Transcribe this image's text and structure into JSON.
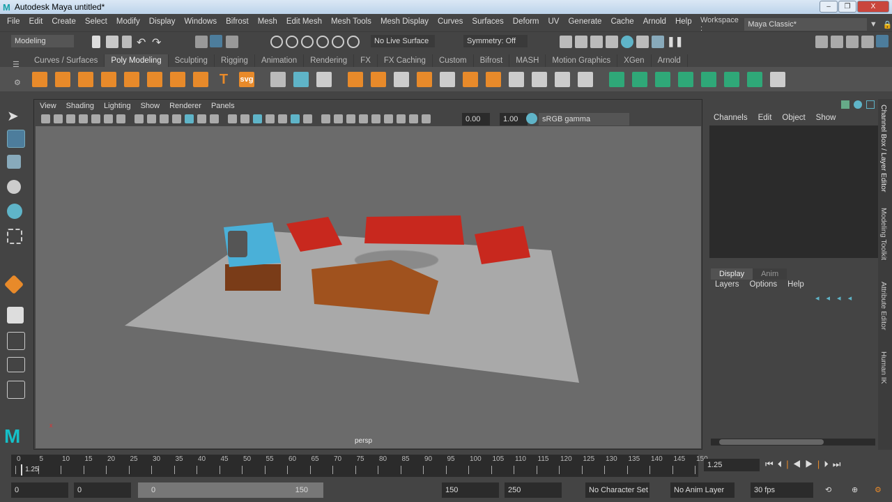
{
  "window": {
    "title": "Autodesk Maya  untitled*",
    "logo": "M",
    "min": "–",
    "max": "❐",
    "close": "X"
  },
  "menu": [
    "File",
    "Edit",
    "Create",
    "Select",
    "Modify",
    "Display",
    "Windows",
    "Bifrost",
    "Mesh",
    "Edit Mesh",
    "Mesh Tools",
    "Mesh Display",
    "Curves",
    "Surfaces",
    "Deform",
    "UV",
    "Generate",
    "Cache",
    "Arnold",
    "Help"
  ],
  "workspace": {
    "label": "Workspace :",
    "value": "Maya Classic*"
  },
  "status": {
    "menuset": "Modeling",
    "live_surface": "No Live Surface",
    "symmetry": "Symmetry: Off"
  },
  "shelf_tabs": [
    "Curves / Surfaces",
    "Poly Modeling",
    "Sculpting",
    "Rigging",
    "Animation",
    "Rendering",
    "FX",
    "FX Caching",
    "Custom",
    "Bifrost",
    "MASH",
    "Motion Graphics",
    "XGen",
    "Arnold"
  ],
  "shelf_active": "Poly Modeling",
  "shelf_icons": [
    "poly-sphere-icon",
    "poly-cube-icon",
    "poly-cylinder-icon",
    "poly-cone-icon",
    "poly-torus-icon",
    "poly-plane-icon",
    "poly-disc-icon",
    "poly-pipe-icon",
    "poly-type-icon",
    "svg-icon",
    "mirror-icon",
    "combine-icon",
    "separate-icon",
    "smooth-icon",
    "extrude-icon",
    "bridge-icon",
    "bevel-icon",
    "multicut-icon",
    "target-weld-icon",
    "insert-edge-loop-icon",
    "quad-draw-icon",
    "crease-icon",
    "uv-editor-icon",
    "cut-uv-icon",
    "unfold-icon",
    "layout-icon",
    "normals-icon",
    "soft-edge-icon",
    "hard-edge-icon",
    "planar-uv-icon",
    "automatic-uv-icon",
    "texture-editor-icon"
  ],
  "shelf_svg_label": "svg",
  "shelf_type_label": "T",
  "viewport": {
    "menu": [
      "View",
      "Shading",
      "Lighting",
      "Show",
      "Renderer",
      "Panels"
    ],
    "exposure": "0.00",
    "gamma": "1.00",
    "color_space": "sRGB gamma",
    "camera": "persp"
  },
  "channel_box": {
    "menu": [
      "Channels",
      "Edit",
      "Object",
      "Show"
    ]
  },
  "layer_editor": {
    "tabs": [
      "Display",
      "Anim"
    ],
    "menu": [
      "Layers",
      "Options",
      "Help"
    ]
  },
  "side_tabs": [
    "Channel Box / Layer Editor",
    "Modeling Toolkit",
    "Attribute Editor",
    "Human IK"
  ],
  "timeline": {
    "ticks": [
      0,
      5,
      10,
      15,
      20,
      25,
      30,
      35,
      40,
      45,
      50,
      55,
      60,
      65,
      70,
      75,
      80,
      85,
      90,
      95,
      100,
      105,
      110,
      115,
      120,
      125,
      130,
      135,
      140,
      145,
      150
    ],
    "current": "1.25",
    "current_field": "1.25",
    "range_start": 0,
    "range_end": 150
  },
  "range": {
    "start": "0",
    "playback_start": "0",
    "slider_start": "0",
    "slider_end": "150",
    "playback_end": "150",
    "end": "250",
    "character_set": "No Character Set",
    "anim_layer": "No Anim Layer",
    "fps": "30 fps"
  },
  "colors": {
    "accent": "#5fb4c8",
    "active_tool": "#4d7d9c",
    "viewport_bg": "#6b6b6b",
    "sofa": "#c8281e",
    "tv": "#4ab0d8",
    "wood": "#a0521e"
  }
}
